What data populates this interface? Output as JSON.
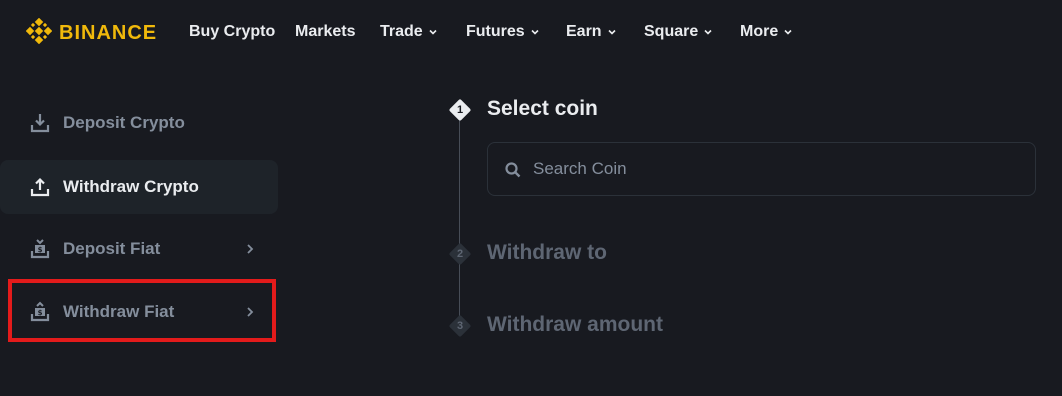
{
  "header": {
    "brand": "BINANCE",
    "brand_color": "#f0b90b",
    "nav": [
      {
        "label": "Buy Crypto",
        "dropdown": false
      },
      {
        "label": "Markets",
        "dropdown": false
      },
      {
        "label": "Trade",
        "dropdown": true
      },
      {
        "label": "Futures",
        "dropdown": true
      },
      {
        "label": "Earn",
        "dropdown": true
      },
      {
        "label": "Square",
        "dropdown": true
      },
      {
        "label": "More",
        "dropdown": true
      }
    ]
  },
  "sidebar": {
    "items": [
      {
        "label": "Deposit Crypto",
        "icon": "download-icon",
        "active": false,
        "has_arrow": false
      },
      {
        "label": "Withdraw Crypto",
        "icon": "upload-icon",
        "active": true,
        "has_arrow": false
      },
      {
        "label": "Deposit Fiat",
        "icon": "deposit-fiat-icon",
        "active": false,
        "has_arrow": true
      },
      {
        "label": "Withdraw Fiat",
        "icon": "withdraw-fiat-icon",
        "active": false,
        "has_arrow": true
      }
    ],
    "highlight_color": "#e31b1b"
  },
  "steps": [
    {
      "number": "1",
      "title": "Select coin",
      "state": "current"
    },
    {
      "number": "2",
      "title": "Withdraw to",
      "state": "todo"
    },
    {
      "number": "3",
      "title": "Withdraw amount",
      "state": "todo"
    }
  ],
  "search": {
    "placeholder": "Search Coin",
    "value": ""
  }
}
